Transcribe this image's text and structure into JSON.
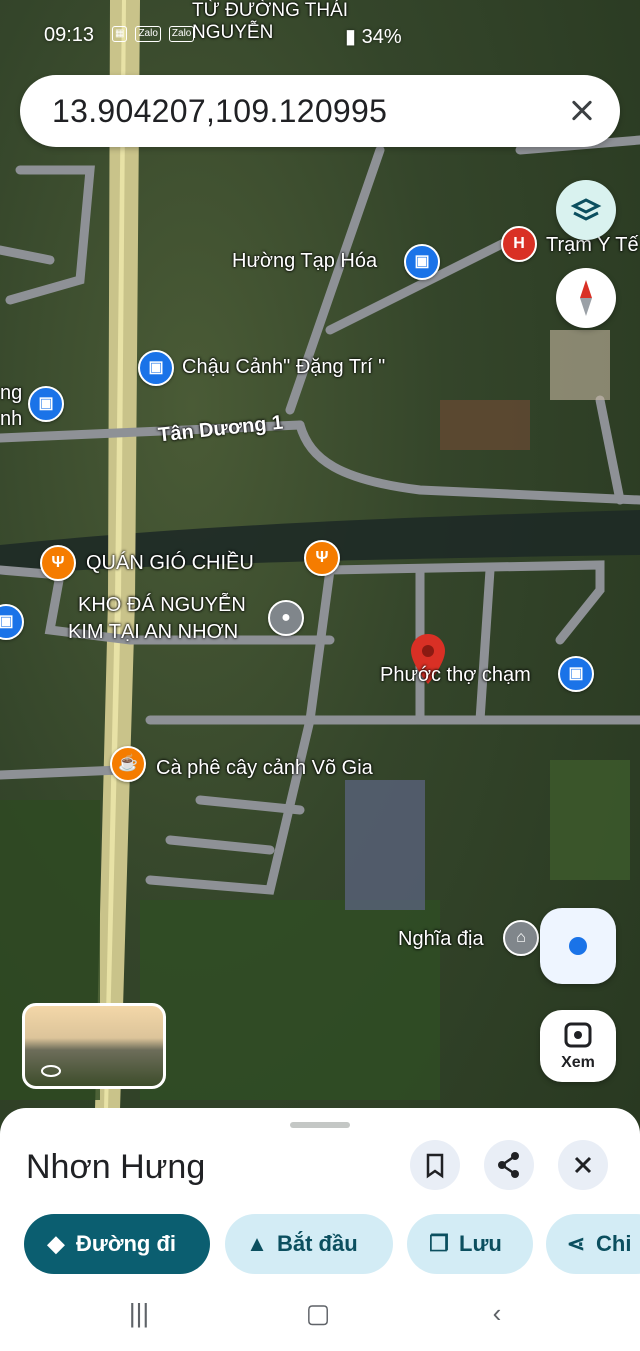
{
  "status": {
    "time": "09:13",
    "notif_icons": [
      "Zalo",
      "Zalo"
    ],
    "battery": "34%"
  },
  "search": {
    "coordinates": "13.904207,109.120995"
  },
  "map": {
    "labels": {
      "top_area": "TỪ ĐƯỜNG THÁI NGUYỄN",
      "huong_tap_hoa": "Hường Tạp Hóa",
      "tram_y_te": "Trạm Y Tế",
      "chau_canh": "Chậu Cảnh\" Đặng Trí \"",
      "tan_duong": "Tân Dương 1",
      "quan_gio": "QUÁN GIÓ CHIỀU",
      "kho_da_1": "KHO ĐÁ NGUYỄN",
      "kho_da_2": "KIM TẠI AN NHƠN",
      "phuoc_tho": "Phước thợ chạm",
      "ca_phe": "Cà phê cây cảnh Võ Gia",
      "nghia_dia": "Nghĩa địa",
      "left_cut_1": "ng",
      "left_cut_2": "nh"
    }
  },
  "controls": {
    "xem_label": "Xem"
  },
  "sheet": {
    "title": "Nhơn Hưng",
    "chips": [
      {
        "label": "Đường đi",
        "icon": "directions-icon"
      },
      {
        "label": "Bắt đầu",
        "icon": "navigation-arrow-icon"
      },
      {
        "label": "Lưu",
        "icon": "bookmark-icon"
      },
      {
        "label": "Chi",
        "icon": "share-icon"
      }
    ]
  },
  "colors": {
    "primary_chip": "#0b5e70",
    "chip_bg": "#d3ecf5",
    "marker_red": "#d93025"
  }
}
